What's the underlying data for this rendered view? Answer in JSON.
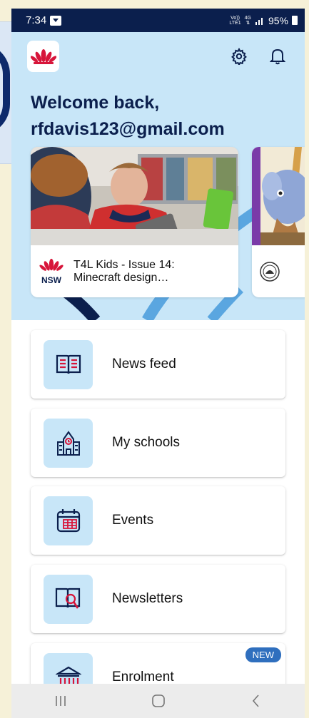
{
  "status_bar": {
    "time": "7:34",
    "network": "4G",
    "carrier_top": "Vo))",
    "carrier_bottom": "LTE1",
    "battery": "95%"
  },
  "header": {
    "welcome_line1": "Welcome back,",
    "welcome_line2": "rfdavis123@gmail.com"
  },
  "featured": [
    {
      "title_line1": "T4L Kids - Issue 14:",
      "title_line2": "Minecraft design…",
      "logo_text": "NSW"
    },
    {
      "title_line1": "",
      "title_line2": ""
    }
  ],
  "menu": [
    {
      "label": "News feed",
      "icon": "news-feed-icon"
    },
    {
      "label": "My schools",
      "icon": "school-icon"
    },
    {
      "label": "Events",
      "icon": "calendar-icon"
    },
    {
      "label": "Newsletters",
      "icon": "newsletter-icon"
    },
    {
      "label": "Enrolment",
      "icon": "enrolment-icon",
      "badge": "NEW"
    }
  ],
  "colors": {
    "navy": "#0b1f4d",
    "hero_bg": "#c8e6f8",
    "nsw_red": "#d7153a",
    "badge_blue": "#2f6fbe"
  }
}
